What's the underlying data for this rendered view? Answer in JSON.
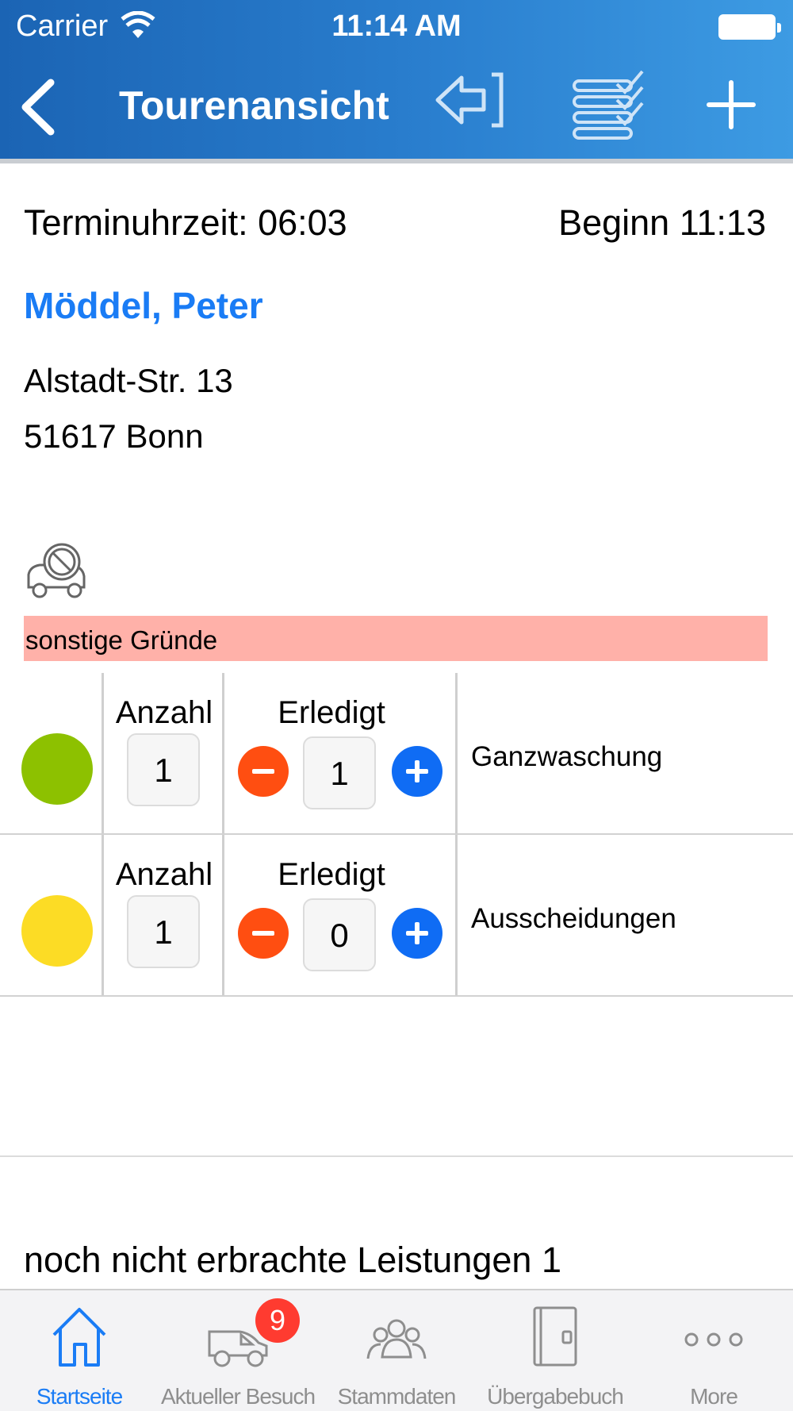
{
  "status_bar": {
    "carrier": "Carrier",
    "time": "11:14 AM"
  },
  "nav": {
    "title": "Tourenansicht"
  },
  "visit": {
    "termin": "Terminuhrzeit: 06:03",
    "beginn": "Beginn 11:13",
    "patient": "Möddel, Peter",
    "street": "Alstadt-Str. 13",
    "city": "51617 Bonn",
    "reason": "sonstige Gründe"
  },
  "services": [
    {
      "status_color": "#8dc100",
      "anzahl_label": "Anzahl",
      "anzahl": "1",
      "erledigt_label": "Erledigt",
      "erledigt": "1",
      "name": "Ganzwaschung"
    },
    {
      "status_color": "#fcdc25",
      "anzahl_label": "Anzahl",
      "anzahl": "1",
      "erledigt_label": "Erledigt",
      "erledigt": "0",
      "name": "Ausscheidungen"
    }
  ],
  "pending": "noch nicht erbrachte Leistungen 1",
  "tabbar": {
    "badge": "9",
    "tabs": [
      {
        "label": "Startseite",
        "icon": "home-icon",
        "active": true
      },
      {
        "label": "Aktueller Besuch",
        "icon": "car-icon"
      },
      {
        "label": "Stammdaten",
        "icon": "people-icon"
      },
      {
        "label": "Übergabebuch",
        "icon": "book-icon"
      },
      {
        "label": "More",
        "icon": "more-icon"
      }
    ]
  },
  "colors": {
    "header": "#2a7fcf",
    "accent": "#1a7cf5",
    "reason_bg": "#ffb1a9",
    "minus": "#ff4e11",
    "plus": "#0f6cf4"
  }
}
